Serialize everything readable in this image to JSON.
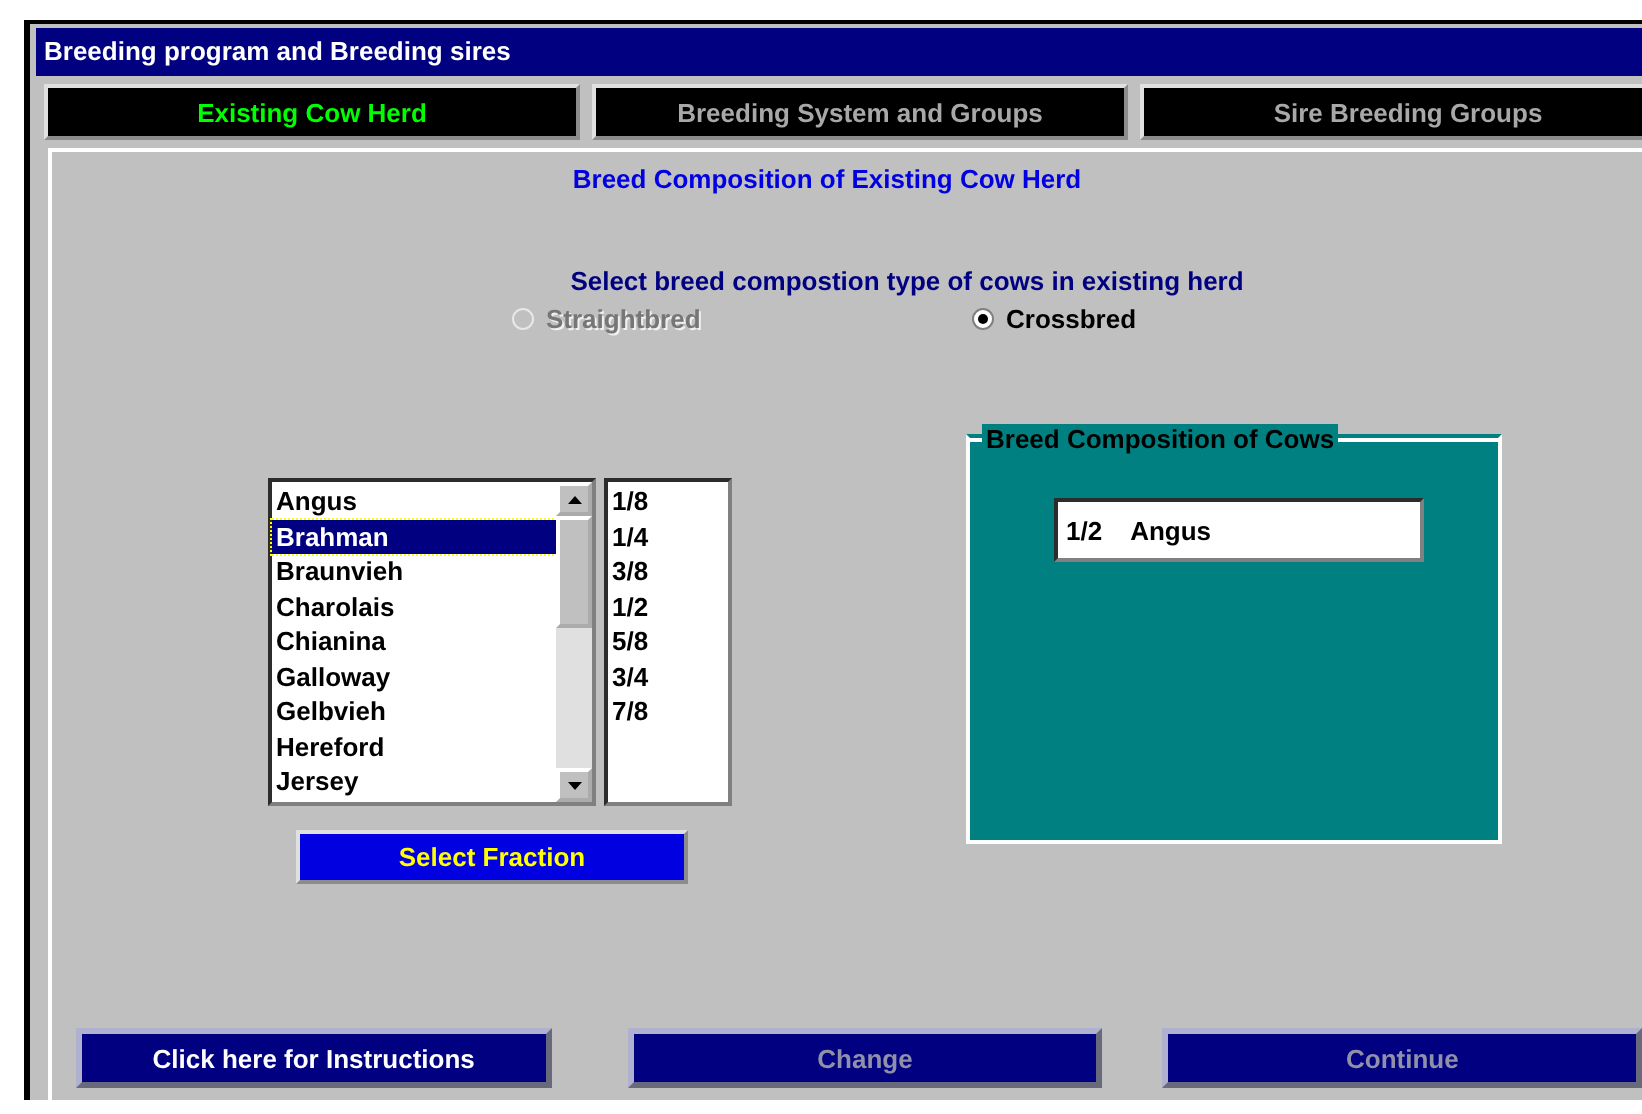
{
  "window": {
    "title": "Breeding program and Breeding sires"
  },
  "tabs": [
    {
      "label": "Existing Cow Herd",
      "selected": true
    },
    {
      "label": "Breeding System and Groups",
      "selected": false
    },
    {
      "label": "Sire Breeding Groups",
      "selected": false
    }
  ],
  "heading": "Breed Composition of Existing Cow Herd",
  "prompt": "Select breed compostion type of cows in existing herd",
  "radios": [
    {
      "label": "Straightbred",
      "selected": false,
      "disabled": true
    },
    {
      "label": "Crossbred",
      "selected": true,
      "disabled": false
    }
  ],
  "breeds": [
    {
      "label": "Angus",
      "selected": false
    },
    {
      "label": "Brahman",
      "selected": true
    },
    {
      "label": "Braunvieh",
      "selected": false
    },
    {
      "label": "Charolais",
      "selected": false
    },
    {
      "label": "Chianina",
      "selected": false
    },
    {
      "label": "Galloway",
      "selected": false
    },
    {
      "label": "Gelbvieh",
      "selected": false
    },
    {
      "label": "Hereford",
      "selected": false
    },
    {
      "label": "Jersey",
      "selected": false
    }
  ],
  "fractions": [
    "1/8",
    "1/4",
    "3/8",
    "1/2",
    "5/8",
    "3/4",
    "7/8"
  ],
  "select_button": "Select Fraction",
  "composition": {
    "title": "Breed Composition of Cows",
    "entries": [
      {
        "fraction": "1/2",
        "breed": "Angus"
      }
    ]
  },
  "buttons": [
    {
      "label": "Click here for Instructions",
      "disabled": false
    },
    {
      "label": "Change",
      "disabled": true
    },
    {
      "label": "Continue",
      "disabled": true
    }
  ]
}
